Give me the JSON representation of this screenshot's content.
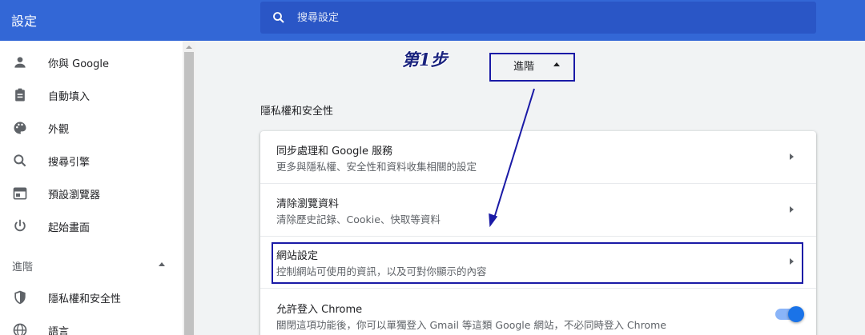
{
  "app": {
    "title": "設定"
  },
  "search": {
    "placeholder": "搜尋設定"
  },
  "sidebar": {
    "items": [
      {
        "label": "你與 Google",
        "icon": "person-icon"
      },
      {
        "label": "自動填入",
        "icon": "clipboard-icon"
      },
      {
        "label": "外觀",
        "icon": "palette-icon"
      },
      {
        "label": "搜尋引擎",
        "icon": "search-icon"
      },
      {
        "label": "預設瀏覽器",
        "icon": "browser-icon"
      },
      {
        "label": "起始畫面",
        "icon": "power-icon"
      }
    ],
    "advanced_label": "進階",
    "advanced_items": [
      {
        "label": "隱私權和安全性",
        "icon": "shield-icon"
      },
      {
        "label": "語言",
        "icon": "globe-icon"
      }
    ]
  },
  "annotation": {
    "step": "第1步"
  },
  "main": {
    "advanced_toggle_label": "進階",
    "section_title": "隱私權和安全性",
    "rows": [
      {
        "title": "同步處理和 Google 服務",
        "subtitle": "更多與隱私權、安全性和資料收集相關的設定"
      },
      {
        "title": "清除瀏覽資料",
        "subtitle": "清除歷史記錄、Cookie、快取等資料"
      },
      {
        "title": "網站設定",
        "subtitle": "控制網站可使用的資訊，以及可對你顯示的內容"
      },
      {
        "title": "允許登入 Chrome",
        "subtitle": "關閉這項功能後，你可以單獨登入 Gmail 等這類 Google 網站，不必同時登入 Chrome",
        "toggle_on": true
      }
    ]
  },
  "colors": {
    "topbar": "#3367d6",
    "accent": "#1a73e8",
    "annotation": "#1a1aa6"
  }
}
